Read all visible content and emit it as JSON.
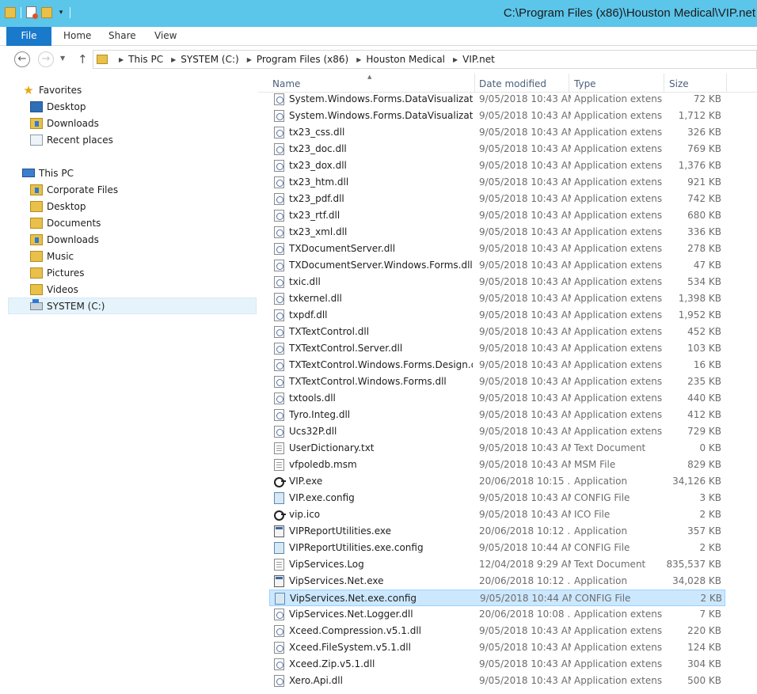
{
  "window": {
    "title": "C:\\Program Files (x86)\\Houston Medical\\VIP.net"
  },
  "ribbon": {
    "tabs": [
      "File",
      "Home",
      "Share",
      "View"
    ]
  },
  "address": {
    "crumbs": [
      "This PC",
      "SYSTEM (C:)",
      "Program Files (x86)",
      "Houston Medical",
      "VIP.net"
    ]
  },
  "nav": {
    "favorites_label": "Favorites",
    "favorites": [
      "Desktop",
      "Downloads",
      "Recent places"
    ],
    "thispc_label": "This PC",
    "thispc": [
      "Corporate Files",
      "Desktop",
      "Documents",
      "Downloads",
      "Music",
      "Pictures",
      "Videos",
      "SYSTEM (C:)"
    ],
    "selected": "SYSTEM (C:)"
  },
  "columns": {
    "name": "Name",
    "date": "Date modified",
    "type": "Type",
    "size": "Size"
  },
  "files": [
    {
      "name": "System.Windows.Forms.DataVisualizatio...",
      "date": "9/05/2018 10:43 AM",
      "type": "Application extens...",
      "size": "72 KB",
      "icon": "dll"
    },
    {
      "name": "System.Windows.Forms.DataVisualizatio...",
      "date": "9/05/2018 10:43 AM",
      "type": "Application extens...",
      "size": "1,712 KB",
      "icon": "dll"
    },
    {
      "name": "tx23_css.dll",
      "date": "9/05/2018 10:43 AM",
      "type": "Application extens...",
      "size": "326 KB",
      "icon": "dll"
    },
    {
      "name": "tx23_doc.dll",
      "date": "9/05/2018 10:43 AM",
      "type": "Application extens...",
      "size": "769 KB",
      "icon": "dll"
    },
    {
      "name": "tx23_dox.dll",
      "date": "9/05/2018 10:43 AM",
      "type": "Application extens...",
      "size": "1,376 KB",
      "icon": "dll"
    },
    {
      "name": "tx23_htm.dll",
      "date": "9/05/2018 10:43 AM",
      "type": "Application extens...",
      "size": "921 KB",
      "icon": "dll"
    },
    {
      "name": "tx23_pdf.dll",
      "date": "9/05/2018 10:43 AM",
      "type": "Application extens...",
      "size": "742 KB",
      "icon": "dll"
    },
    {
      "name": "tx23_rtf.dll",
      "date": "9/05/2018 10:43 AM",
      "type": "Application extens...",
      "size": "680 KB",
      "icon": "dll"
    },
    {
      "name": "tx23_xml.dll",
      "date": "9/05/2018 10:43 AM",
      "type": "Application extens...",
      "size": "336 KB",
      "icon": "dll"
    },
    {
      "name": "TXDocumentServer.dll",
      "date": "9/05/2018 10:43 AM",
      "type": "Application extens...",
      "size": "278 KB",
      "icon": "dll"
    },
    {
      "name": "TXDocumentServer.Windows.Forms.dll",
      "date": "9/05/2018 10:43 AM",
      "type": "Application extens...",
      "size": "47 KB",
      "icon": "dll"
    },
    {
      "name": "txic.dll",
      "date": "9/05/2018 10:43 AM",
      "type": "Application extens...",
      "size": "534 KB",
      "icon": "dll"
    },
    {
      "name": "txkernel.dll",
      "date": "9/05/2018 10:43 AM",
      "type": "Application extens...",
      "size": "1,398 KB",
      "icon": "dll"
    },
    {
      "name": "txpdf.dll",
      "date": "9/05/2018 10:43 AM",
      "type": "Application extens...",
      "size": "1,952 KB",
      "icon": "dll"
    },
    {
      "name": "TXTextControl.dll",
      "date": "9/05/2018 10:43 AM",
      "type": "Application extens...",
      "size": "452 KB",
      "icon": "dll"
    },
    {
      "name": "TXTextControl.Server.dll",
      "date": "9/05/2018 10:43 AM",
      "type": "Application extens...",
      "size": "103 KB",
      "icon": "dll"
    },
    {
      "name": "TXTextControl.Windows.Forms.Design.dll",
      "date": "9/05/2018 10:43 AM",
      "type": "Application extens...",
      "size": "16 KB",
      "icon": "dll"
    },
    {
      "name": "TXTextControl.Windows.Forms.dll",
      "date": "9/05/2018 10:43 AM",
      "type": "Application extens...",
      "size": "235 KB",
      "icon": "dll"
    },
    {
      "name": "txtools.dll",
      "date": "9/05/2018 10:43 AM",
      "type": "Application extens...",
      "size": "440 KB",
      "icon": "dll"
    },
    {
      "name": "Tyro.Integ.dll",
      "date": "9/05/2018 10:43 AM",
      "type": "Application extens...",
      "size": "412 KB",
      "icon": "dll"
    },
    {
      "name": "Ucs32P.dll",
      "date": "9/05/2018 10:43 AM",
      "type": "Application extens...",
      "size": "729 KB",
      "icon": "dll"
    },
    {
      "name": "UserDictionary.txt",
      "date": "9/05/2018 10:43 AM",
      "type": "Text Document",
      "size": "0 KB",
      "icon": "text"
    },
    {
      "name": "vfpoledb.msm",
      "date": "9/05/2018 10:43 AM",
      "type": "MSM File",
      "size": "829 KB",
      "icon": "text"
    },
    {
      "name": "VIP.exe",
      "date": "20/06/2018 10:15 ...",
      "type": "Application",
      "size": "34,126 KB",
      "icon": "exe"
    },
    {
      "name": "VIP.exe.config",
      "date": "9/05/2018 10:43 AM",
      "type": "CONFIG File",
      "size": "3 KB",
      "icon": "config"
    },
    {
      "name": "vip.ico",
      "date": "9/05/2018 10:43 AM",
      "type": "ICO File",
      "size": "2 KB",
      "icon": "exe"
    },
    {
      "name": "VIPReportUtilities.exe",
      "date": "20/06/2018 10:12 ...",
      "type": "Application",
      "size": "357 KB",
      "icon": "app"
    },
    {
      "name": "VIPReportUtilities.exe.config",
      "date": "9/05/2018 10:44 AM",
      "type": "CONFIG File",
      "size": "2 KB",
      "icon": "config"
    },
    {
      "name": "VipServices.Log",
      "date": "12/04/2018 9:29 AM",
      "type": "Text Document",
      "size": "835,537 KB",
      "icon": "text"
    },
    {
      "name": "VipServices.Net.exe",
      "date": "20/06/2018 10:12 ...",
      "type": "Application",
      "size": "34,028 KB",
      "icon": "app"
    },
    {
      "name": "VipServices.Net.exe.config",
      "date": "9/05/2018 10:44 AM",
      "type": "CONFIG File",
      "size": "2 KB",
      "icon": "config",
      "selected": true
    },
    {
      "name": "VipServices.Net.Logger.dll",
      "date": "20/06/2018 10:08 ...",
      "type": "Application extens...",
      "size": "7 KB",
      "icon": "dll"
    },
    {
      "name": "Xceed.Compression.v5.1.dll",
      "date": "9/05/2018 10:43 AM",
      "type": "Application extens...",
      "size": "220 KB",
      "icon": "dll"
    },
    {
      "name": "Xceed.FileSystem.v5.1.dll",
      "date": "9/05/2018 10:43 AM",
      "type": "Application extens...",
      "size": "124 KB",
      "icon": "dll"
    },
    {
      "name": "Xceed.Zip.v5.1.dll",
      "date": "9/05/2018 10:43 AM",
      "type": "Application extens...",
      "size": "304 KB",
      "icon": "dll"
    },
    {
      "name": "Xero.Api.dll",
      "date": "9/05/2018 10:43 AM",
      "type": "Application extens...",
      "size": "500 KB",
      "icon": "dll"
    }
  ]
}
